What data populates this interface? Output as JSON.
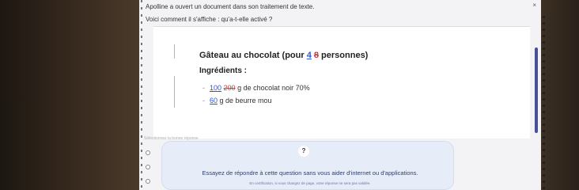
{
  "header": {
    "intro": "Apolline a ouvert un document dans son traitement de texte.",
    "question": "Voici comment il s'affiche : qu'a-t-elle activé ?",
    "close_icon": "close-icon"
  },
  "document": {
    "title_prefix": "Gâteau au chocolat (pour ",
    "title_inserted": "4",
    "title_deleted": "8",
    "title_suffix": " personnes)",
    "ingredients_heading": "Ingrédients :",
    "items": [
      {
        "bullet": "-",
        "inserted": "100",
        "deleted": "200",
        "rest": " g de chocolat noir 70%"
      },
      {
        "bullet": "-",
        "inserted": "60",
        "deleted": "",
        "rest": " g de beurre mou"
      }
    ],
    "colors": {
      "inserted": "#2f55c8",
      "deleted": "#c83a3a"
    }
  },
  "answer": {
    "select_label": "Sélectionnez la bonne réponse",
    "choice_count_visible": 3
  },
  "overlay": {
    "icon": "question-mark",
    "message": "Essayez de répondre à cette question sans vous aider d'internet ou d'applications.",
    "note": "En certification, si vous changez de page, votre réponse ne sera pas validée."
  }
}
